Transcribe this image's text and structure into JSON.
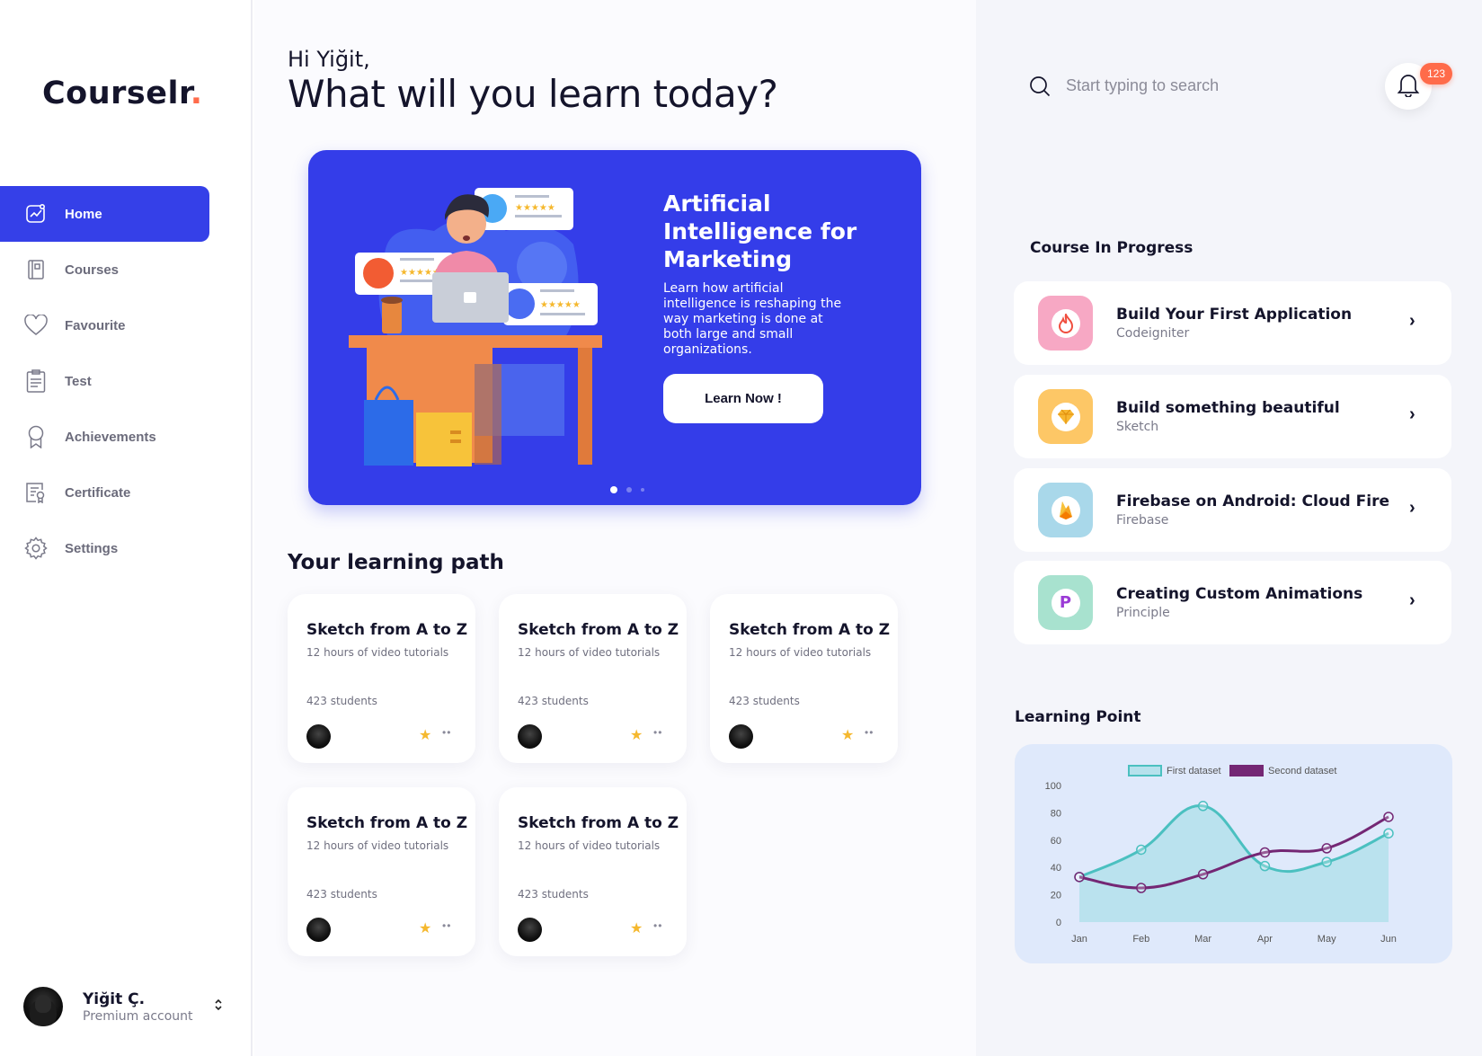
{
  "app": {
    "logo_text": "Courselr",
    "logo_dot": "."
  },
  "sidebar": {
    "items": [
      {
        "label": "Home",
        "icon": "chart-icon",
        "active": true
      },
      {
        "label": "Courses",
        "icon": "book-icon",
        "active": false
      },
      {
        "label": "Favourite",
        "icon": "heart-icon",
        "active": false
      },
      {
        "label": "Test",
        "icon": "clipboard-icon",
        "active": false
      },
      {
        "label": "Achievements",
        "icon": "award-icon",
        "active": false
      },
      {
        "label": "Certificate",
        "icon": "certificate-icon",
        "active": false
      },
      {
        "label": "Settings",
        "icon": "gear-icon",
        "active": false
      }
    ],
    "user": {
      "name": "Yiğit Ç.",
      "plan": "Premium account"
    }
  },
  "main": {
    "greeting": "Hi Yiğit,",
    "headline": "What will you learn today?",
    "hero": {
      "title": "Artificial Intelligence for Marketing",
      "description": "Learn how artificial intelligence is reshaping the way marketing is done at both large and small organizations.",
      "button_label": "Learn Now !",
      "slides": 3,
      "active_slide": 1
    },
    "learning_path_title": "Your learning path",
    "learning_path": [
      {
        "title": "Sketch from A to Z",
        "subtitle": "12 hours of video tutorials",
        "students": "423 students"
      },
      {
        "title": "Sketch from A to Z",
        "subtitle": "12 hours of video tutorials",
        "students": "423 students"
      },
      {
        "title": "Sketch from A to Z",
        "subtitle": "12 hours of video tutorials",
        "students": "423 students"
      },
      {
        "title": "Sketch from A to Z",
        "subtitle": "12 hours of video tutorials",
        "students": "423 students"
      },
      {
        "title": "Sketch from A to Z",
        "subtitle": "12 hours of video tutorials",
        "students": "423 students"
      }
    ]
  },
  "right": {
    "search": {
      "placeholder": "Start typing to search",
      "value": ""
    },
    "notifications": {
      "count": "123"
    },
    "course_in_progress_title": "Course In Progress",
    "courses": [
      {
        "title": "Build Your First Application",
        "subtitle": "Codeigniter",
        "icon": "flame-icon",
        "color": "#f7a8c4",
        "glyph_color": "#f04e3e"
      },
      {
        "title": "Build something beautiful",
        "subtitle": "Sketch",
        "icon": "diamond-icon",
        "color": "#fdc766",
        "glyph_color": "#f5a623"
      },
      {
        "title": "Firebase on Android: Cloud Fire",
        "subtitle": "Firebase",
        "icon": "firebase-icon",
        "color": "#a9d8ea",
        "glyph_color": "#f5a623"
      },
      {
        "title": "Creating Custom Animations",
        "subtitle": "Principle",
        "icon": "principle-icon",
        "color": "#a8e2cf",
        "glyph_color": "#9b3bd6"
      }
    ],
    "learning_point_title": "Learning Point"
  },
  "chart_data": {
    "type": "line",
    "categories": [
      "Jan",
      "Feb",
      "Mar",
      "Apr",
      "May",
      "Jun"
    ],
    "ylim": [
      0,
      100
    ],
    "yticks": [
      0,
      20,
      40,
      60,
      80,
      100
    ],
    "legend_position": "top",
    "series": [
      {
        "name": "First dataset",
        "values": [
          33,
          53,
          85,
          41,
          44,
          65
        ],
        "color": "#4bc0c0",
        "fill": "#b6e1ec",
        "filled": true
      },
      {
        "name": "Second dataset",
        "values": [
          33,
          25,
          35,
          51,
          54,
          77
        ],
        "color": "#742774",
        "filled": false
      }
    ]
  }
}
